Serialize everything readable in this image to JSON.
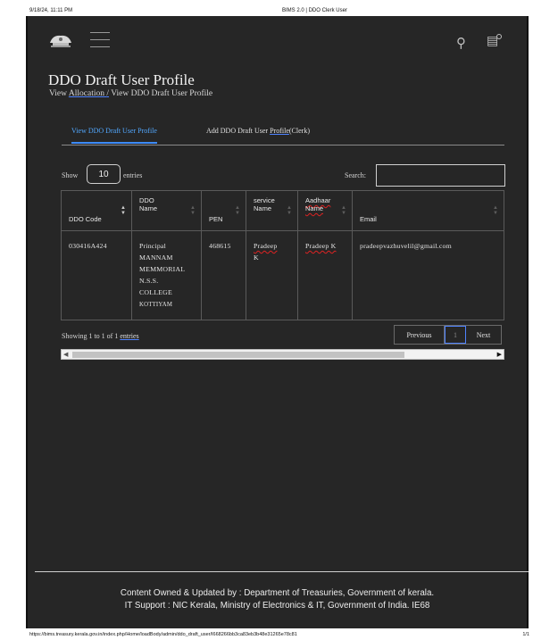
{
  "print_header": {
    "datetime": "9/18/24, 11:11 PM",
    "title": "BIMS 2.0 | DDO Clerk User"
  },
  "topbar": {
    "logo_icon": "kerala-emblem-icon",
    "menu_icon": "hamburger-icon",
    "search_icon": "search-icon",
    "notification_icon": "notification-icon"
  },
  "page": {
    "title": "DDO Draft User Profile",
    "breadcrumb": {
      "prefix": "View",
      "link": "Allocation",
      "sep": "/",
      "current": "View DDO Draft User Profile"
    }
  },
  "tabs": [
    {
      "label": "View DDO Draft User Profile",
      "active": true
    },
    {
      "label_a": "Add DDO Draft User ",
      "label_b": "Profile",
      "label_c": "(Clerk)",
      "active": false
    }
  ],
  "controls": {
    "show_label": "Show",
    "page_length": "10",
    "entries_label": "entries",
    "search_label": "Search:",
    "search_value": ""
  },
  "table": {
    "headers": [
      "DDO Code",
      "DDO Name",
      "PEN",
      "service Name",
      "Aadhaar Name",
      "Email"
    ],
    "rows": [
      {
        "ddo_code": "030416A424",
        "ddo_name_1": "Principal",
        "ddo_name_2": "MANNAM",
        "ddo_name_3": "MEMMORIAL",
        "ddo_name_4": "N.S.S.",
        "ddo_name_5": "COLLEGE",
        "ddo_name_6": "KOTTIYAM",
        "pen": "468615",
        "service_name_1": "Pradeep",
        "service_name_2": "K",
        "aadhaar_name": "Pradeep K",
        "email": "pradeepvazhuvelil@gmail.com"
      }
    ]
  },
  "table_info": {
    "text": "Showing 1 to 1 of 1 ",
    "link": "entries"
  },
  "pagination": {
    "previous": "Previous",
    "current": "1",
    "next": "Next"
  },
  "footer": {
    "line1": "Content Owned & Updated by : Department of Treasuries, Government of kerala.",
    "line2": "IT Support : NIC Kerala, Ministry of Electronics & IT, Government of India. IE68"
  },
  "print_footer": {
    "url": "https://bims.treasury.kerala.gov.in/index.php/Home/loadBody/admin/ddo_draft_user/I668266bb3ca83eb3b48e31265e78c81",
    "page": "1/1"
  }
}
